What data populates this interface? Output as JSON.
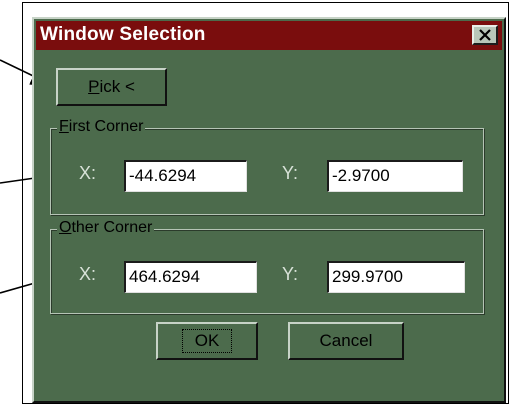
{
  "window": {
    "title": "Window Selection",
    "close_glyph": "✕"
  },
  "pick": {
    "label_underlined": "P",
    "label_rest": "ick <"
  },
  "first_corner": {
    "legend_underlined": "F",
    "legend_rest": "irst Corner",
    "x_label": "X:",
    "x_value": "-44.6294",
    "y_label": "Y:",
    "y_value": "-2.9700"
  },
  "other_corner": {
    "legend_underlined": "O",
    "legend_rest": "ther Corner",
    "x_label": "X:",
    "x_value": "464.6294",
    "y_label": "Y:",
    "y_value": "299.9700"
  },
  "buttons": {
    "ok": "OK",
    "cancel": "Cancel"
  },
  "colors": {
    "dialog_bg": "#4c6b4c",
    "title_bg": "#7a0d0d"
  }
}
